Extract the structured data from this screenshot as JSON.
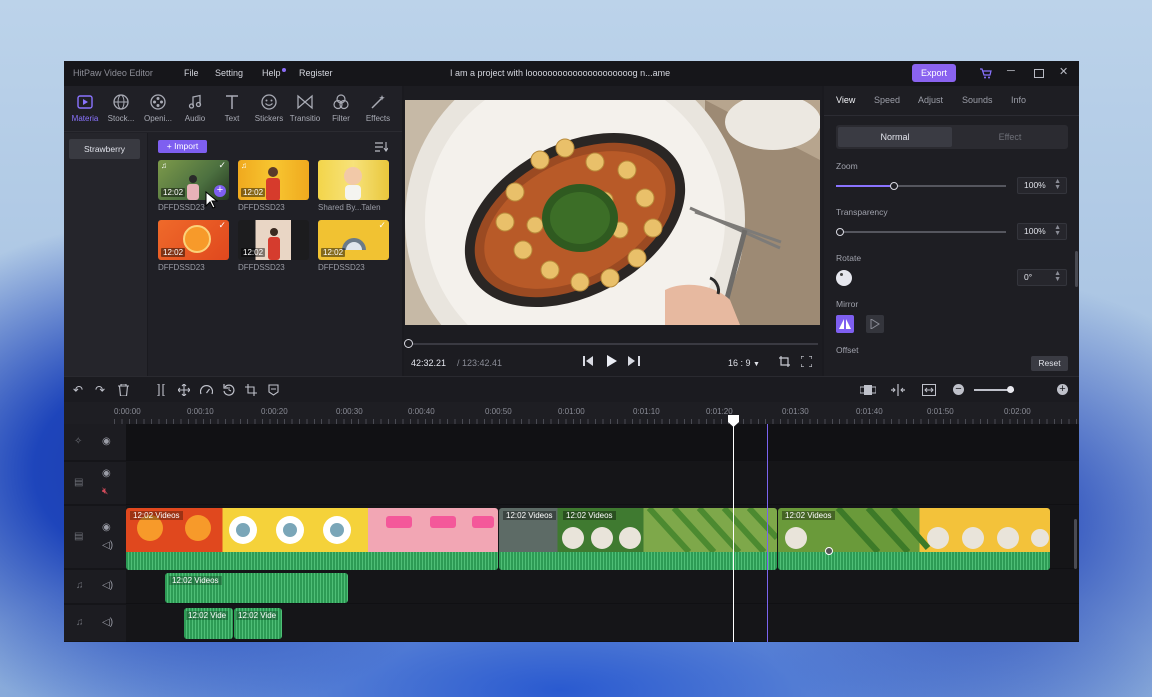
{
  "titlebar": {
    "app_name": "HitPaw Video Editor",
    "menu": [
      "File",
      "Setting",
      "Help",
      "Register"
    ],
    "project_title": "I am a project with looooooooooooooooooooog n...ame",
    "export_label": "Export"
  },
  "media_tabs": [
    {
      "label": "Materia",
      "icon": "play-square-icon"
    },
    {
      "label": "Stock...",
      "icon": "globe-icon"
    },
    {
      "label": "Openi...",
      "icon": "film-reel-icon"
    },
    {
      "label": "Audio",
      "icon": "music-note-icon"
    },
    {
      "label": "Text",
      "icon": "text-icon"
    },
    {
      "label": "Stickers",
      "icon": "smiley-icon"
    },
    {
      "label": "Transitio",
      "icon": "bowtie-icon"
    },
    {
      "label": "Filter",
      "icon": "filter-circles-icon"
    },
    {
      "label": "Effects",
      "icon": "magic-wand-icon"
    }
  ],
  "library": {
    "folder": "Strawberry",
    "import_label": "+ Import",
    "items": [
      {
        "name": "DFFDSSD23",
        "duration": "12:02"
      },
      {
        "name": "DFFDSSD23",
        "duration": "12:02"
      },
      {
        "name": "Shared By...Talen",
        "duration": ""
      },
      {
        "name": "DFFDSSD23",
        "duration": "12:02"
      },
      {
        "name": "DFFDSSD23",
        "duration": "12:02"
      },
      {
        "name": "DFFDSSD23",
        "duration": "12:02"
      }
    ]
  },
  "preview": {
    "current_time": "42:32.21",
    "total_time": "/ 123:42.41",
    "aspect": "16 : 9",
    "progress": 0.0
  },
  "properties": {
    "tabs": [
      "View",
      "Speed",
      "Adjust",
      "Sounds",
      "Info"
    ],
    "modes": [
      "Normal",
      "Effect"
    ],
    "zoom_label": "Zoom",
    "zoom_value": "100%",
    "zoom_level": 0.34,
    "transparency_label": "Transparency",
    "transparency_value": "100%",
    "rotate_label": "Rotate",
    "rotate_value": "0°",
    "mirror_label": "Mirror",
    "offset_label": "Offset",
    "reset_label": "Reset"
  },
  "timeline": {
    "ruler": [
      "0:00:00",
      "0:00:10",
      "0:00:20",
      "0:00:30",
      "0:00:40",
      "0:00:50",
      "0:01:00",
      "0:01:10",
      "0:01:20",
      "0:01:30",
      "0:01:40",
      "0:01:50",
      "0:02:00"
    ],
    "clips": [
      {
        "label": "12:02  Videos"
      },
      {
        "label": "12:02  Videos"
      },
      {
        "label": "12:02  Videos"
      },
      {
        "label": "12:02  Videos"
      },
      {
        "label": "12:02  Videos"
      },
      {
        "label": "12:02  Vide"
      },
      {
        "label": "12:02  Vide"
      }
    ]
  },
  "colors": {
    "accent": "#8a63f0",
    "audio_green": "#2d9b55",
    "playhead": "#ffffff",
    "marker": "#7a63f0"
  }
}
